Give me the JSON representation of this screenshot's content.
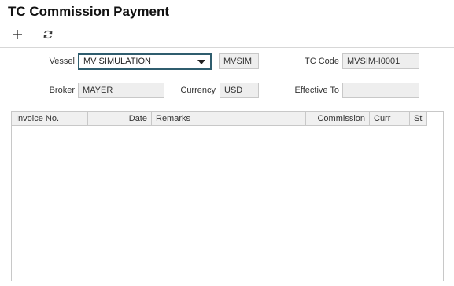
{
  "page": {
    "title": "TC Commission Payment"
  },
  "toolbar": {
    "add_icon": "plus-icon",
    "refresh_icon": "refresh-icon"
  },
  "form": {
    "vessel": {
      "label": "Vessel",
      "value": "MV SIMULATION",
      "code": "MVSIM"
    },
    "tc_code": {
      "label": "TC Code",
      "value": "MVSIM-I0001"
    },
    "broker": {
      "label": "Broker",
      "value": "MAYER"
    },
    "currency": {
      "label": "Currency",
      "value": "USD"
    },
    "effective_to": {
      "label": "Effective To",
      "value": ""
    }
  },
  "grid": {
    "columns": [
      "Invoice No.",
      "Date",
      "Remarks",
      "Commission",
      "Curr",
      "St"
    ],
    "rows": []
  },
  "colors": {
    "accent": "#2f5d6e",
    "field_bg": "#eeeeee",
    "border": "#c8c8c8"
  }
}
